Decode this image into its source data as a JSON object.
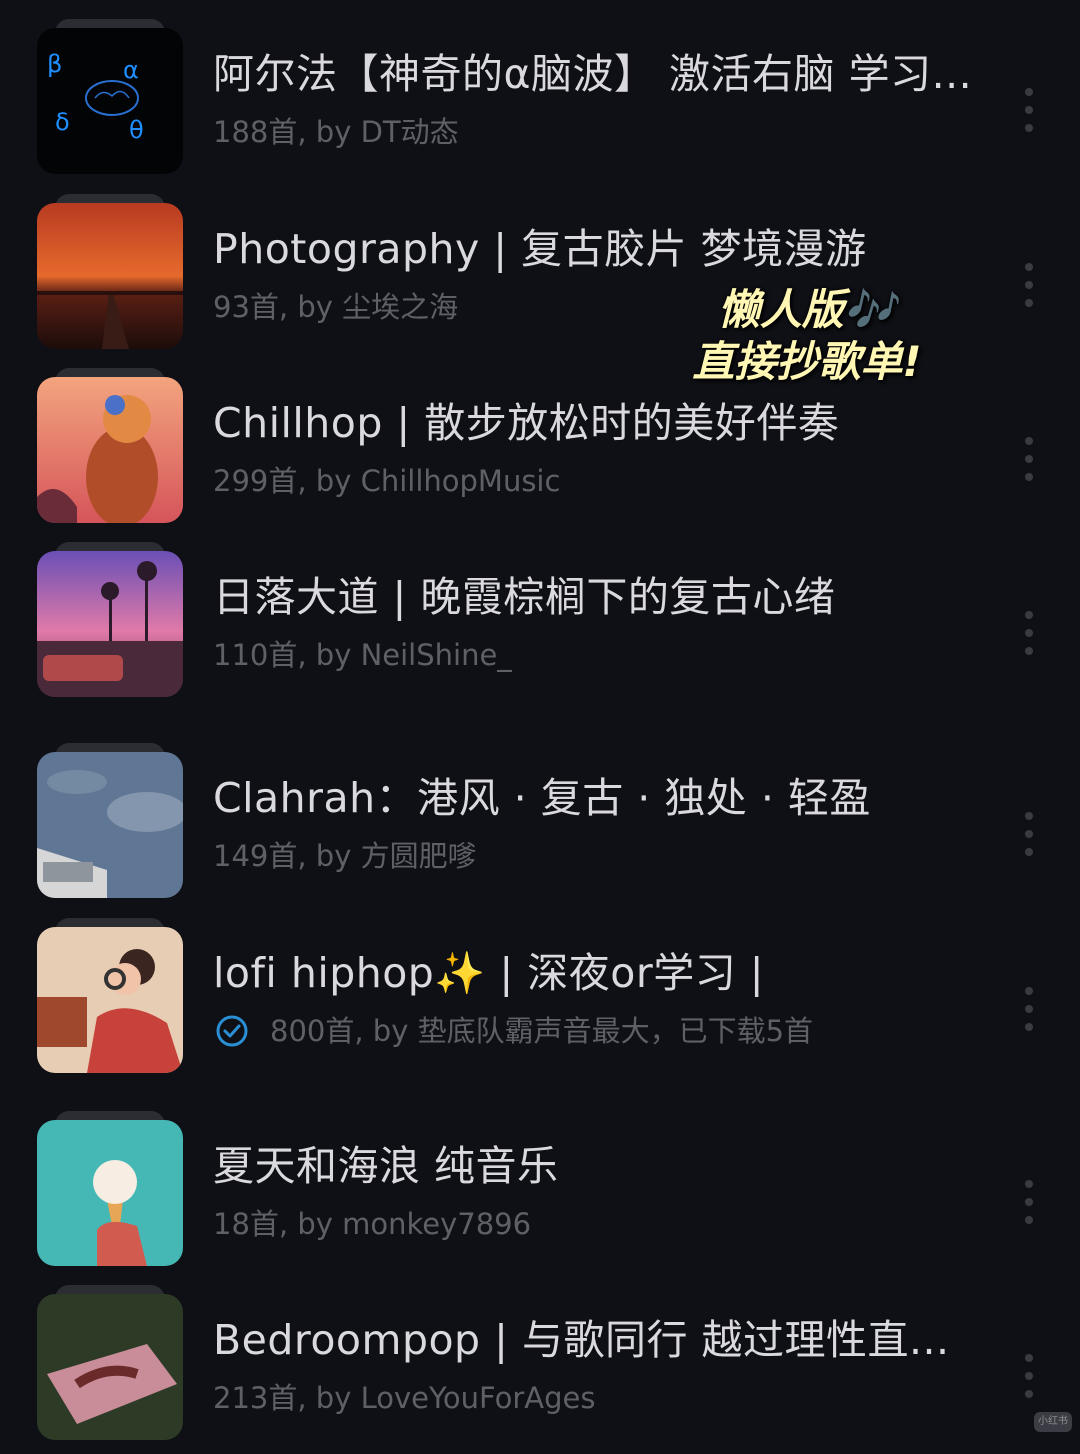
{
  "playlists": [
    {
      "title": "阿尔法【神奇的α脑波】 激活右脑 学习...",
      "count": "188首",
      "by": "by DT动态",
      "verified": false,
      "icon": "alpha-brainwave-cover"
    },
    {
      "title": "Photography | 复古胶片 梦境漫游",
      "count": "93首",
      "by": "by 尘埃之海",
      "verified": false,
      "icon": "sunset-road-cover"
    },
    {
      "title": "Chillhop | 散步放松时的美好伴奏",
      "count": "299首",
      "by": "by ChillhopMusic",
      "verified": false,
      "icon": "raccoon-headphones-cover"
    },
    {
      "title": "日落大道 | 晚霞棕榈下的复古心绪",
      "count": "110首",
      "by": "by NeilShine_",
      "verified": false,
      "icon": "palm-sunset-car-cover"
    },
    {
      "title": "Clahrah：港风 · 复古 · 独处 · 轻盈",
      "count": "149首",
      "by": "by 方圆肥嗲",
      "verified": false,
      "icon": "cloudy-sky-building-cover"
    },
    {
      "title": "lofi hiphop✨ | 深夜or学习 |",
      "count": "800首",
      "by": "by 垫底队霸声音最大，已下载5首",
      "verified": true,
      "icon": "lofi-girl-cover"
    },
    {
      "title": "夏天和海浪 纯音乐",
      "count": "18首",
      "by": "by monkey7896",
      "verified": false,
      "icon": "ice-cream-cover"
    },
    {
      "title": "Bedroompop | 与歌同行 越过理性直...",
      "count": "213首",
      "by": "by LoveYouForAges",
      "verified": false,
      "icon": "bed-on-grass-cover"
    }
  ],
  "overlay": {
    "line1": "懒人版",
    "line1_note": "🎶",
    "line2": "直接抄歌单!"
  },
  "watermark": "小红书",
  "colors": {
    "background": "#0f1015",
    "title": "#d9d9de",
    "subtitle": "#5e6068",
    "overlay_text": "#fff7b3",
    "verified_badge": "#2b8fd6"
  }
}
